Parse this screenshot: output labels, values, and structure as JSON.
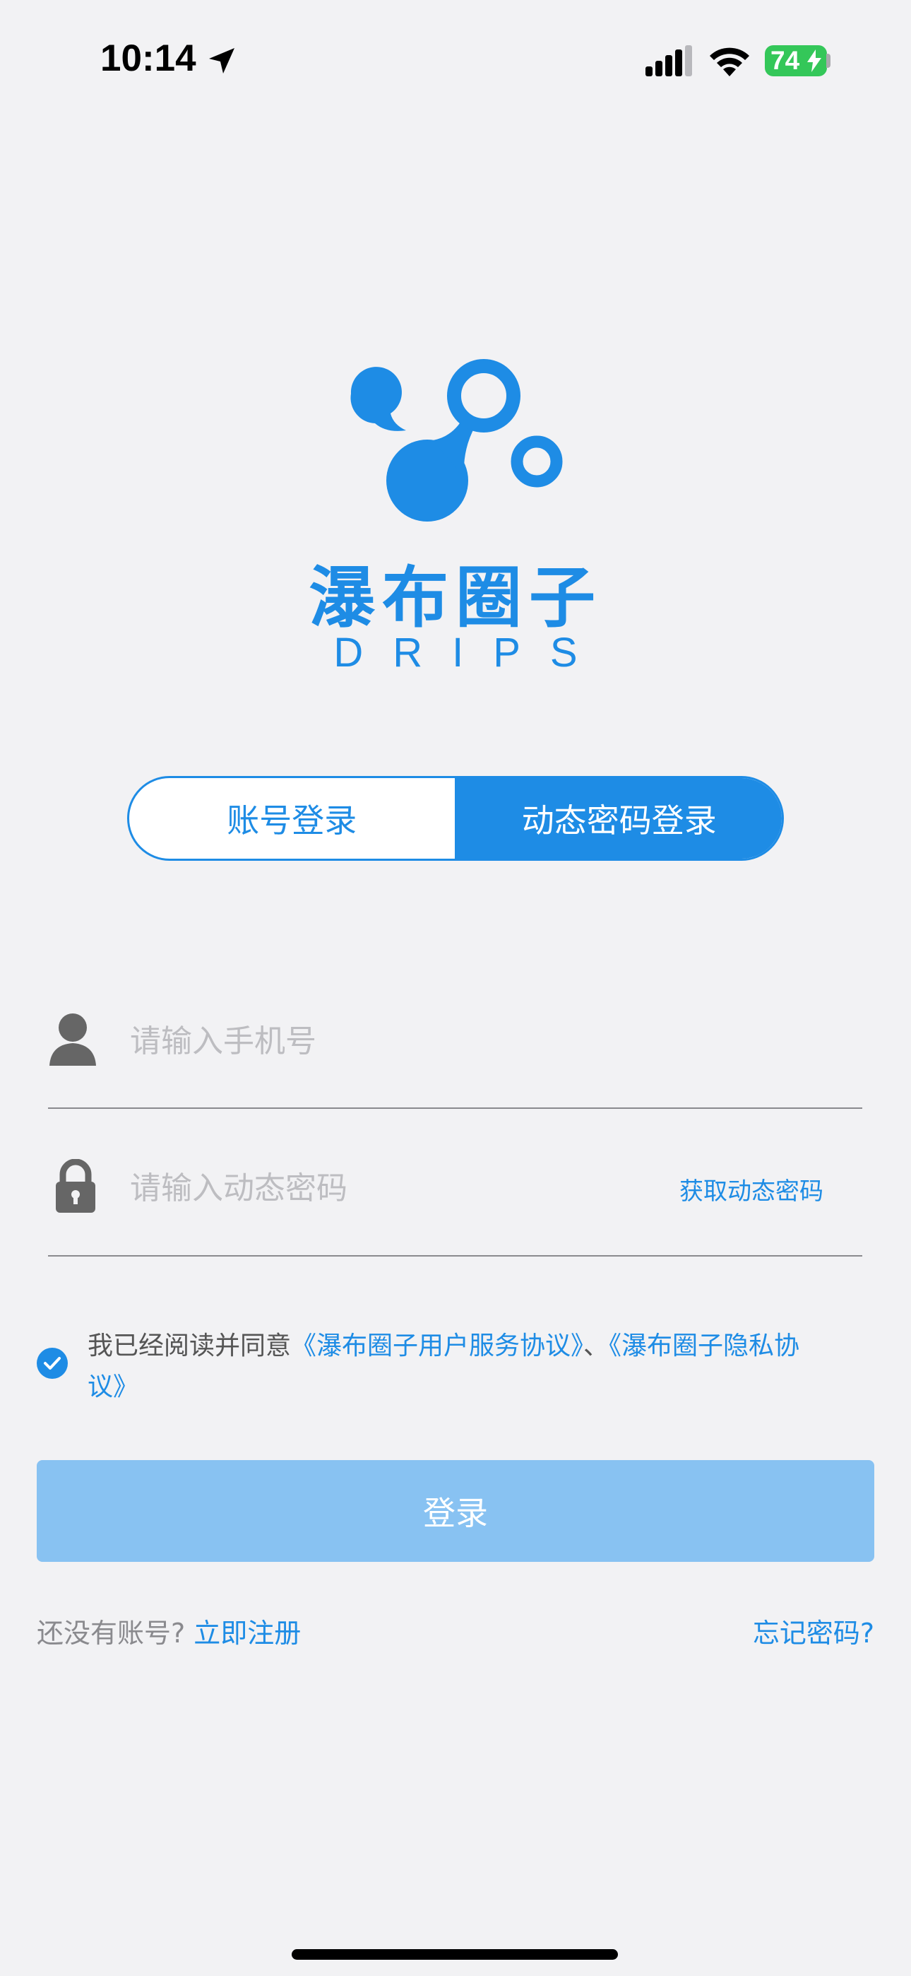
{
  "status_bar": {
    "time": "10:14",
    "battery": "74",
    "icons": [
      "location-arrow-icon",
      "cellular-signal-icon",
      "wifi-icon",
      "battery-charging-icon"
    ]
  },
  "logo": {
    "name_cn": "瀑布圈子",
    "name_en": "DRIPS"
  },
  "tabs": [
    {
      "label": "账号登录",
      "active": false
    },
    {
      "label": "动态密码登录",
      "active": true
    }
  ],
  "form": {
    "phone": {
      "placeholder": "请输入手机号",
      "icon": "user-icon"
    },
    "code": {
      "placeholder": "请输入动态密码",
      "icon": "lock-icon",
      "action": "获取动态密码"
    }
  },
  "agreement": {
    "checked": true,
    "prefix": "我已经阅读并同意",
    "terms": "《瀑布圈子用户服务协议》",
    "separator": "、",
    "privacy": "《瀑布圈子隐私协议》"
  },
  "login_button": "登录",
  "footer": {
    "no_account": "还没有账号?",
    "register": "立即注册",
    "forgot": "忘记密码?"
  },
  "colors": {
    "accent": "#1e8ce5",
    "button_disabled": "#88c2f2",
    "background": "#f2f2f4",
    "battery": "#34c759"
  }
}
